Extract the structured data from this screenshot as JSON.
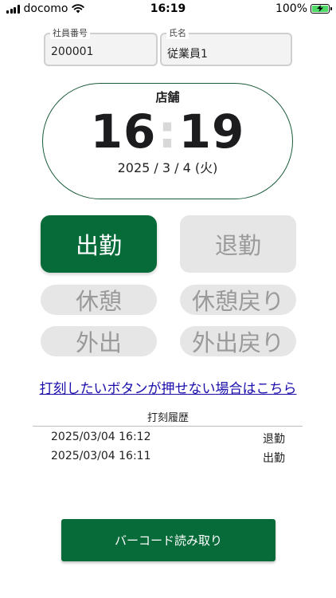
{
  "status_bar": {
    "carrier": "docomo",
    "time": "16:19",
    "battery": "100%",
    "icons": [
      "signal-icon",
      "wifi-icon",
      "battery-charging-icon"
    ]
  },
  "employee": {
    "id_label": "社員番号",
    "id_value": "200001",
    "name_label": "氏名",
    "name_value": "従業員1"
  },
  "clock": {
    "store": "店舗",
    "hours": "16",
    "separator": ":",
    "minutes": "19",
    "date": "2025 / 3 / 4 (火)"
  },
  "buttons": {
    "clock_in": "出勤",
    "clock_out": "退勤",
    "break_start": "休憩",
    "break_end": "休憩戻り",
    "go_out": "外出",
    "return": "外出戻り"
  },
  "help_link": "打刻したいボタンが押せない場合はこちら",
  "history": {
    "title": "打刻履歴",
    "rows": [
      {
        "timestamp": "2025/03/04 16:12",
        "type": "退勤"
      },
      {
        "timestamp": "2025/03/04 16:11",
        "type": "出勤"
      }
    ]
  },
  "barcode_button": "バーコード読み取り",
  "colors": {
    "accent": "#066a39",
    "disabled_bg": "#e6e6e6",
    "disabled_text": "#9a9a9a",
    "link": "#1a0dab"
  }
}
